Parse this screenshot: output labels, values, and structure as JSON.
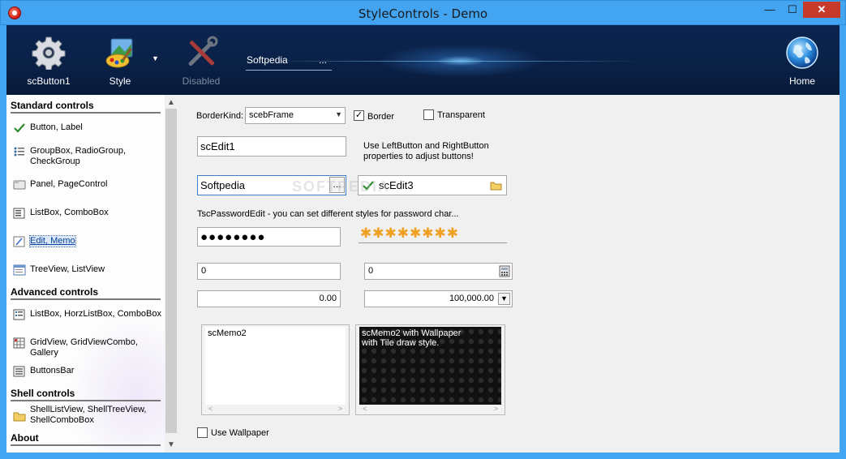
{
  "window": {
    "title": "StyleControls - Demo",
    "minimize": "—",
    "maximize": "☐",
    "close": "✕"
  },
  "header": {
    "buttons": [
      {
        "label": "scButton1"
      },
      {
        "label": "Style"
      },
      {
        "label": "Disabled"
      }
    ],
    "edit": {
      "value": "Softpedia",
      "button": "..."
    },
    "home": {
      "label": "Home"
    }
  },
  "sidebar": {
    "sections": [
      {
        "title": "Standard controls",
        "items": [
          {
            "label": "Button, Label",
            "icon": "check-icon"
          },
          {
            "label": "GroupBox, RadioGroup,",
            "label2": "CheckGroup",
            "icon": "list-dots-icon"
          },
          {
            "label": "Panel, PageControl",
            "icon": "panel-icon"
          },
          {
            "label": "ListBox, ComboBox",
            "icon": "listbox-icon"
          },
          {
            "label": "Edit, Memo",
            "icon": "edit-icon",
            "selected": true
          },
          {
            "label": "TreeView, ListView",
            "icon": "tree-icon"
          }
        ]
      },
      {
        "title": "Advanced controls",
        "items": [
          {
            "label": "ListBox, HorzListBox, ComboBox",
            "icon": "listbox2-icon"
          },
          {
            "label": "GridView, GridViewCombo, Gallery",
            "icon": "grid-icon"
          },
          {
            "label": "ButtonsBar",
            "icon": "buttonsbar-icon"
          }
        ]
      },
      {
        "title": "Shell controls",
        "items": [
          {
            "label": "ShellListView, ShellTreeView,",
            "label2": "ShellComboBox",
            "icon": "folder-icon"
          }
        ]
      },
      {
        "title": "About",
        "items": []
      }
    ]
  },
  "content": {
    "borderkind_label": "BorderKind:",
    "borderkind_value": "scebFrame",
    "border_label": "Border",
    "border_checked": true,
    "transparent_label": "Transparent",
    "transparent_checked": false,
    "edit1": "scEdit1",
    "hint_line1": "Use LeftButton and RightButton",
    "hint_line2": "properties to adjust buttons!",
    "edit2": "Softpedia",
    "edit2_button": "...",
    "edit3": "scEdit3",
    "password_label": "TscPasswordEdit - you can set different styles for password char...",
    "password_dots": "●●●●●●●●",
    "password_stars": "✱✱✱✱✱✱✱✱",
    "num1": "0",
    "num2": "0",
    "cur1": "0.00",
    "cur2": "100,000.00",
    "memo1": "scMemo2",
    "memo2_line1": "scMemo2 with Wallpaper",
    "memo2_line2": "with Tile draw style.",
    "use_wallpaper": "Use Wallpaper",
    "watermark": "SOFTPEDIA"
  }
}
